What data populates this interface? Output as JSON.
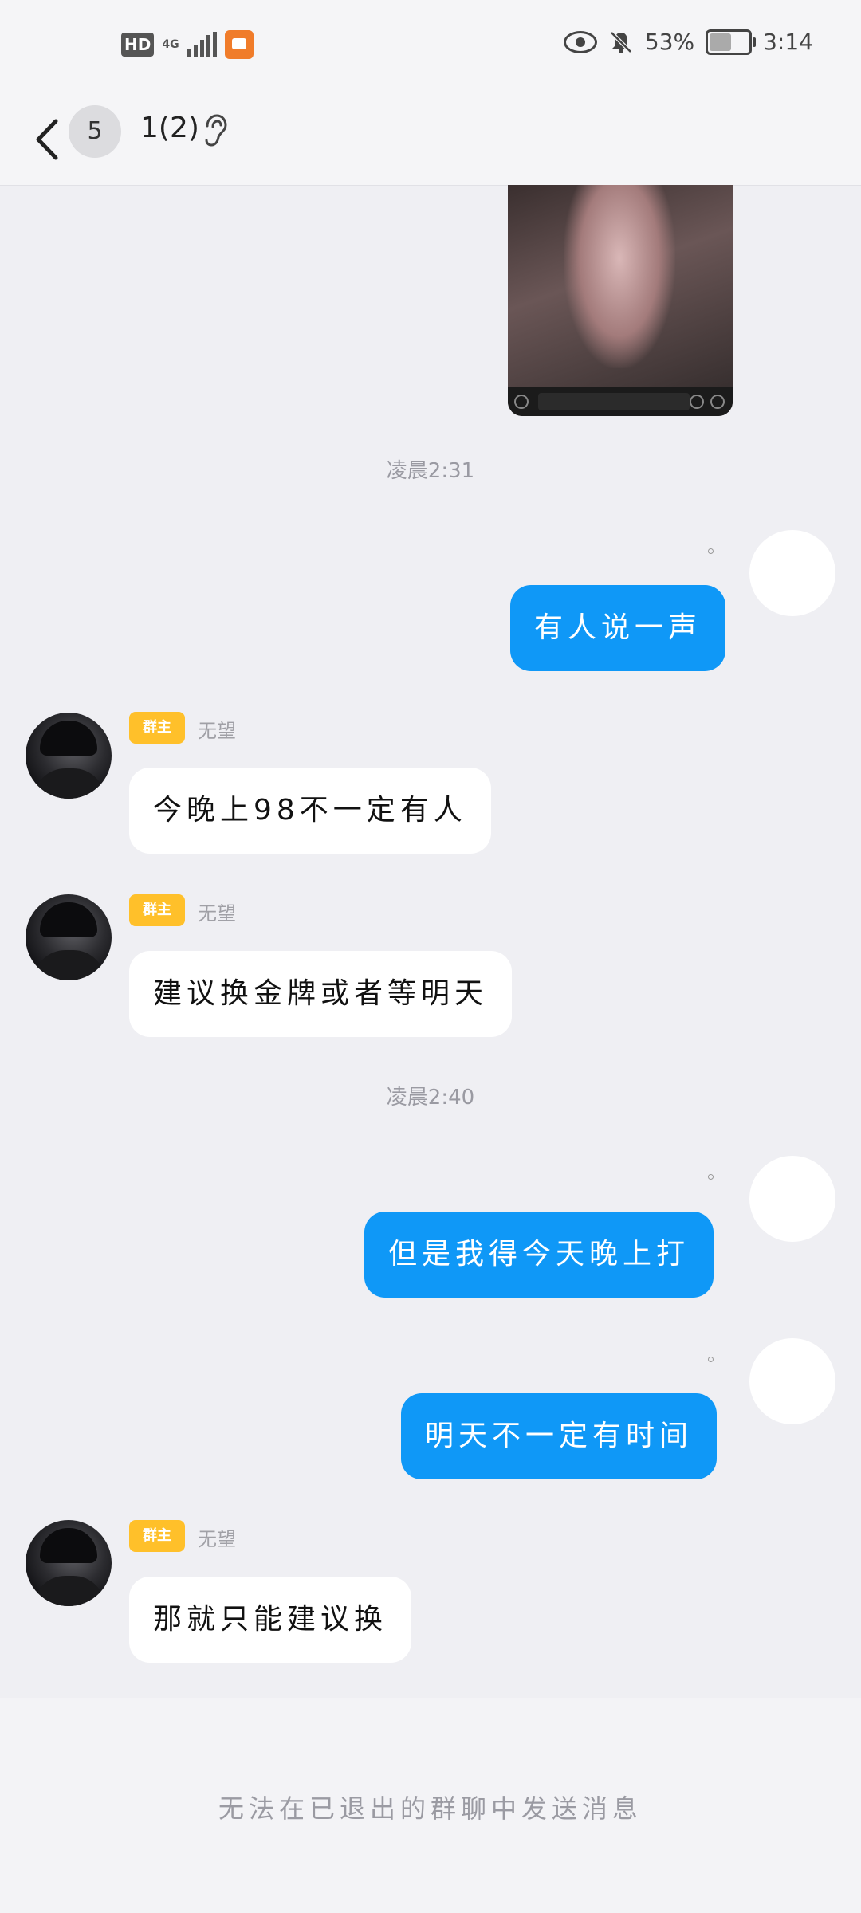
{
  "status_bar": {
    "hd": "HD",
    "network": "4G",
    "battery_percent": "53%",
    "time": "3:14",
    "icons": [
      "hd-icon",
      "signal-icon",
      "app-notification-icon",
      "eye-icon",
      "bell-off-icon",
      "battery-icon"
    ]
  },
  "header": {
    "unread_count": "5",
    "title": "1(2)",
    "icons": [
      "back-icon",
      "ear-icon"
    ]
  },
  "messages": [
    {
      "type": "image"
    },
    {
      "type": "timestamp",
      "text": "凌晨2:31"
    },
    {
      "type": "outgoing",
      "text": "有人说一声"
    },
    {
      "type": "incoming",
      "badge": "群主",
      "nickname": "无望",
      "text": "今晚上98不一定有人"
    },
    {
      "type": "incoming",
      "badge": "群主",
      "nickname": "无望",
      "text": "建议换金牌或者等明天"
    },
    {
      "type": "timestamp",
      "text": "凌晨2:40"
    },
    {
      "type": "outgoing",
      "text": "但是我得今天晚上打"
    },
    {
      "type": "outgoing",
      "text": "明天不一定有时间"
    },
    {
      "type": "incoming",
      "badge": "群主",
      "nickname": "无望",
      "text": "那就只能建议换"
    }
  ],
  "footer": {
    "notice": "无法在已退出的群聊中发送消息"
  }
}
